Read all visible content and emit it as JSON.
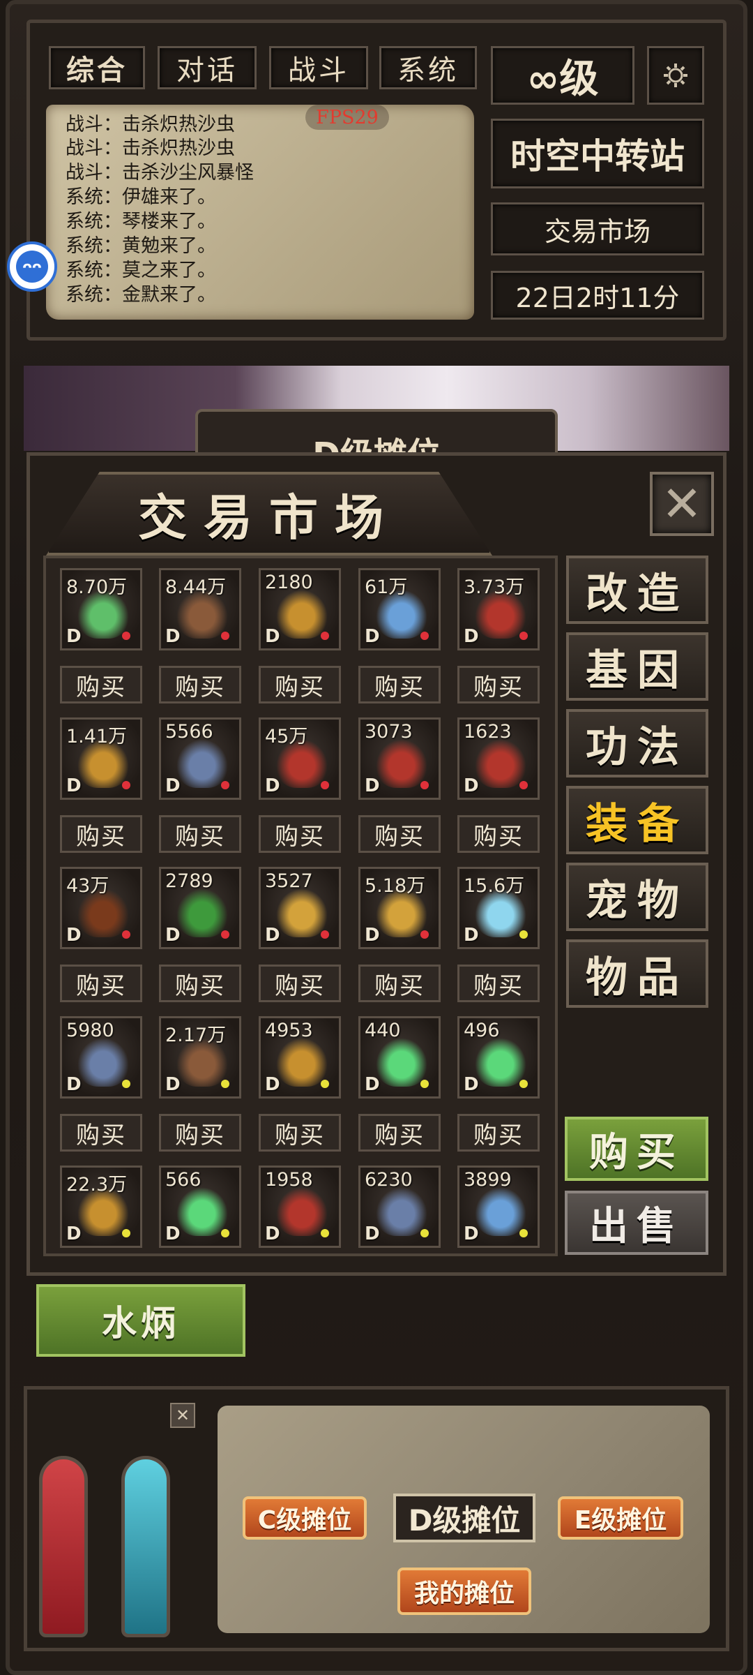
{
  "tabs": [
    "综合",
    "对话",
    "战斗",
    "系统"
  ],
  "level": "∞级",
  "location": "时空中转站",
  "market_link": "交易市场",
  "game_time": "22日2时11分",
  "fps": "FPS29",
  "chat_bubble_icon": "ᴖᴖ",
  "log": [
    "战斗：击杀炽热沙虫",
    "战斗：击杀炽热沙虫",
    "战斗：击杀沙尘风暴怪",
    "系统：伊雄来了。",
    "系统：琴楼来了。",
    "系统：黄勉来了。",
    "系统：莫之来了。",
    "系统：金默来了。"
  ],
  "banner_title": "D级摊位",
  "market_title": "交易市场",
  "close_symbol": "✕",
  "categories": [
    "改造",
    "基因",
    "功法",
    "装备",
    "宠物",
    "物品"
  ],
  "active_category": "装备",
  "buy_label": "购买",
  "buy_big": "购买",
  "sell_big": "出售",
  "player_name": "水炳",
  "items": [
    {
      "price": "8.70万",
      "grade": "D",
      "dot": "#e0313a",
      "icon": "necklace-icon"
    },
    {
      "price": "8.44万",
      "grade": "D",
      "dot": "#e0313a",
      "icon": "gauntlet-icon"
    },
    {
      "price": "2180",
      "grade": "D",
      "dot": "#e0313a",
      "icon": "boots-icon"
    },
    {
      "price": "61万",
      "grade": "D",
      "dot": "#e0313a",
      "icon": "ring-icon"
    },
    {
      "price": "3.73万",
      "grade": "D",
      "dot": "#e0313a",
      "icon": "belt-icon"
    },
    {
      "price": "1.41万",
      "grade": "D",
      "dot": "#e0313a",
      "icon": "boots-icon"
    },
    {
      "price": "5566",
      "grade": "D",
      "dot": "#e0313a",
      "icon": "helmet-icon"
    },
    {
      "price": "45万",
      "grade": "D",
      "dot": "#e0313a",
      "icon": "belt-icon"
    },
    {
      "price": "3073",
      "grade": "D",
      "dot": "#e0313a",
      "icon": "belt-icon"
    },
    {
      "price": "1623",
      "grade": "D",
      "dot": "#e0313a",
      "icon": "belt-icon"
    },
    {
      "price": "43万",
      "grade": "D",
      "dot": "#e0313a",
      "icon": "staff-icon"
    },
    {
      "price": "2789",
      "grade": "D",
      "dot": "#e0313a",
      "icon": "vine-staff-icon"
    },
    {
      "price": "3527",
      "grade": "D",
      "dot": "#e0313a",
      "icon": "armor-icon"
    },
    {
      "price": "5.18万",
      "grade": "D",
      "dot": "#e0313a",
      "icon": "armor-icon"
    },
    {
      "price": "15.6万",
      "grade": "D",
      "dot": "#e8e23a",
      "icon": "lightning-staff-icon"
    },
    {
      "price": "5980",
      "grade": "D",
      "dot": "#e8e23a",
      "icon": "helmet-icon"
    },
    {
      "price": "2.17万",
      "grade": "D",
      "dot": "#e8e23a",
      "icon": "gauntlet-icon"
    },
    {
      "price": "4953",
      "grade": "D",
      "dot": "#e8e23a",
      "icon": "boots-icon"
    },
    {
      "price": "440",
      "grade": "D",
      "dot": "#e8e23a",
      "icon": "sword-icon"
    },
    {
      "price": "496",
      "grade": "D",
      "dot": "#e8e23a",
      "icon": "sword-icon"
    },
    {
      "price": "22.3万",
      "grade": "D",
      "dot": "#e8e23a",
      "icon": "boots-icon"
    },
    {
      "price": "566",
      "grade": "D",
      "dot": "#e8e23a",
      "icon": "sword-icon"
    },
    {
      "price": "1958",
      "grade": "D",
      "dot": "#e8e23a",
      "icon": "belt-icon"
    },
    {
      "price": "6230",
      "grade": "D",
      "dot": "#e8e23a",
      "icon": "helmet-icon"
    },
    {
      "price": "3899",
      "grade": "D",
      "dot": "#e8e23a",
      "icon": "ring-icon"
    }
  ],
  "stalls": {
    "c": "C级摊位",
    "d": "D级摊位",
    "e": "E级摊位",
    "mine": "我的摊位"
  },
  "mini_close": "✕",
  "colors": {
    "active_category": "#f7c325",
    "red_dot": "#e0313a",
    "yellow_dot": "#e8e23a",
    "fps": "#e23b2f"
  }
}
